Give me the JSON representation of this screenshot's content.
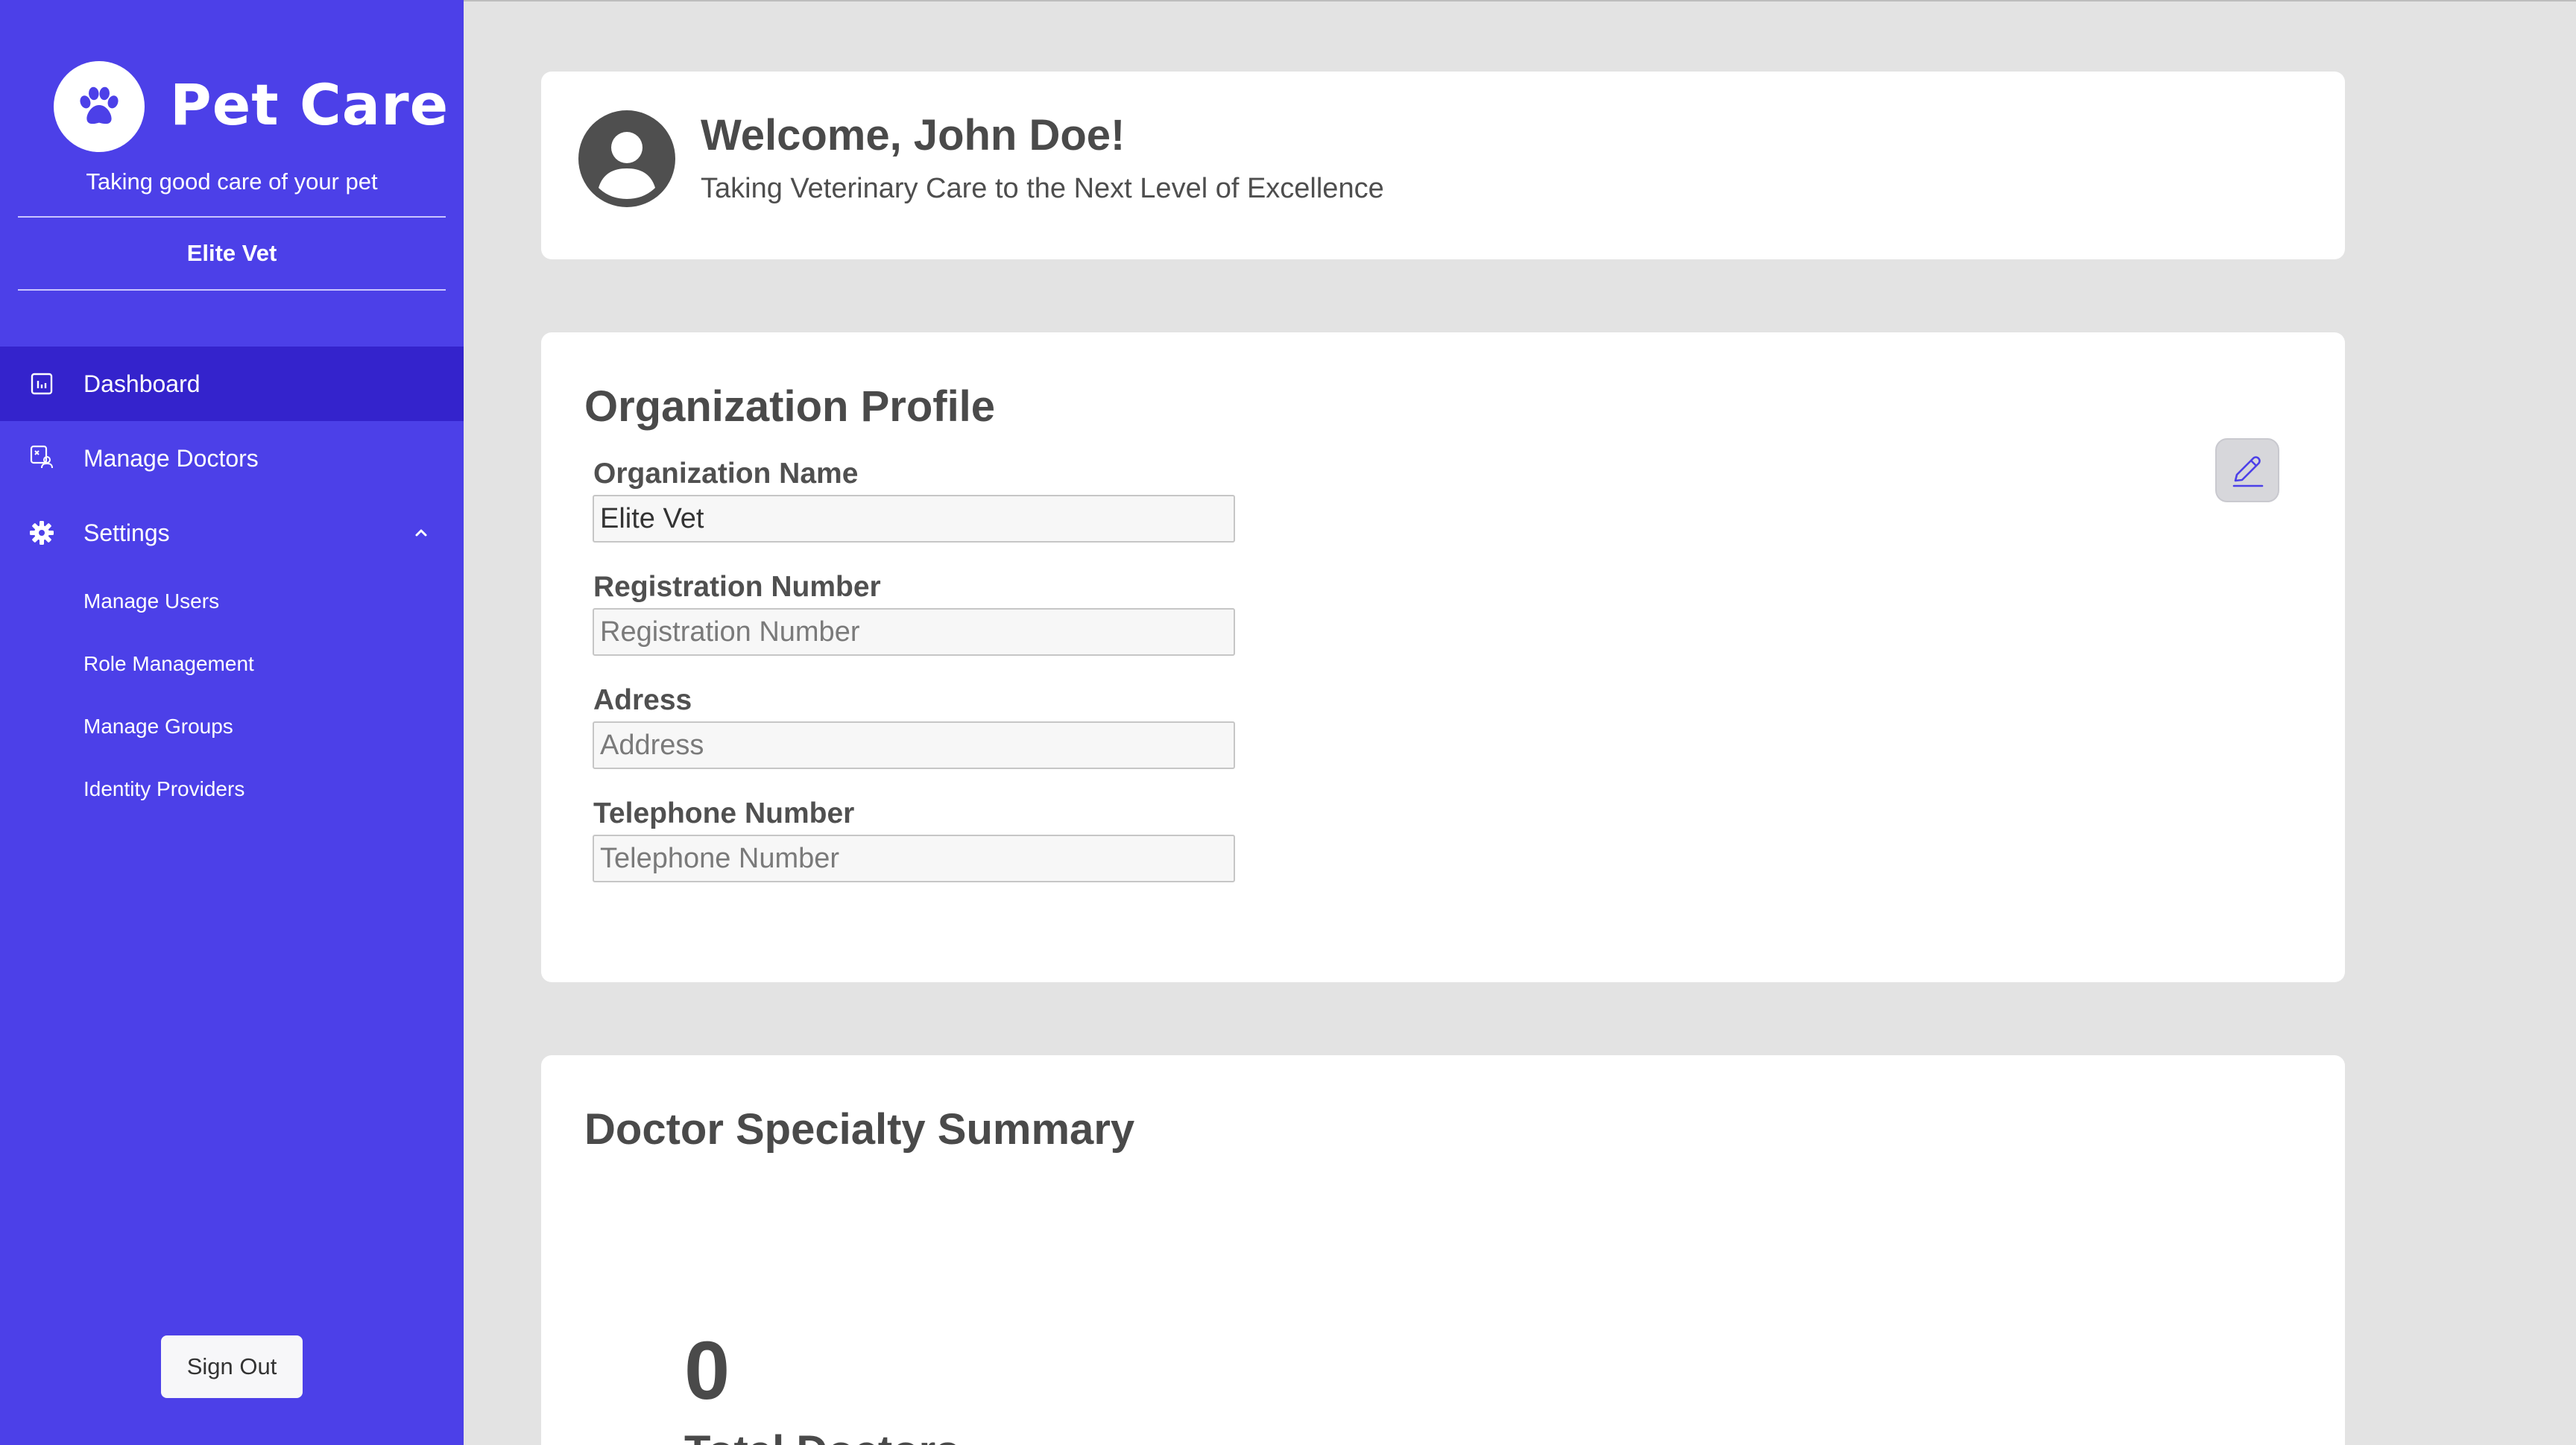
{
  "brand": {
    "name": "Pet Care",
    "tagline": "Taking good care of your pet"
  },
  "sidebar": {
    "organization": "Elite Vet",
    "nav": [
      {
        "label": "Dashboard",
        "icon": "dashboard-icon",
        "active": true
      },
      {
        "label": "Manage Doctors",
        "icon": "doctors-icon",
        "active": false
      },
      {
        "label": "Settings",
        "icon": "gear-icon",
        "active": false,
        "expanded": true
      }
    ],
    "settings_items": [
      {
        "label": "Manage Users"
      },
      {
        "label": "Role Management"
      },
      {
        "label": "Manage Groups"
      },
      {
        "label": "Identity Providers"
      }
    ],
    "sign_out": "Sign Out"
  },
  "welcome": {
    "title": "Welcome, John Doe!",
    "subtitle": "Taking Veterinary Care to the Next Level of Excellence"
  },
  "profile": {
    "title": "Organization Profile",
    "fields": [
      {
        "label": "Organization Name",
        "value": "Elite Vet",
        "placeholder": "Organization Name"
      },
      {
        "label": "Registration Number",
        "value": "",
        "placeholder": "Registration Number"
      },
      {
        "label": "Adress",
        "value": "",
        "placeholder": "Address"
      },
      {
        "label": "Telephone Number",
        "value": "",
        "placeholder": "Telephone Number"
      }
    ],
    "edit_icon": "pencil-icon"
  },
  "specialty": {
    "title": "Doctor Specialty Summary",
    "total_value": "0",
    "total_label": "Total Doctors"
  },
  "colors": {
    "sidebar_bg": "#4c40e8",
    "sidebar_active": "#3423cc",
    "page_bg": "#e3e3e3",
    "accent": "#4c40e8"
  }
}
